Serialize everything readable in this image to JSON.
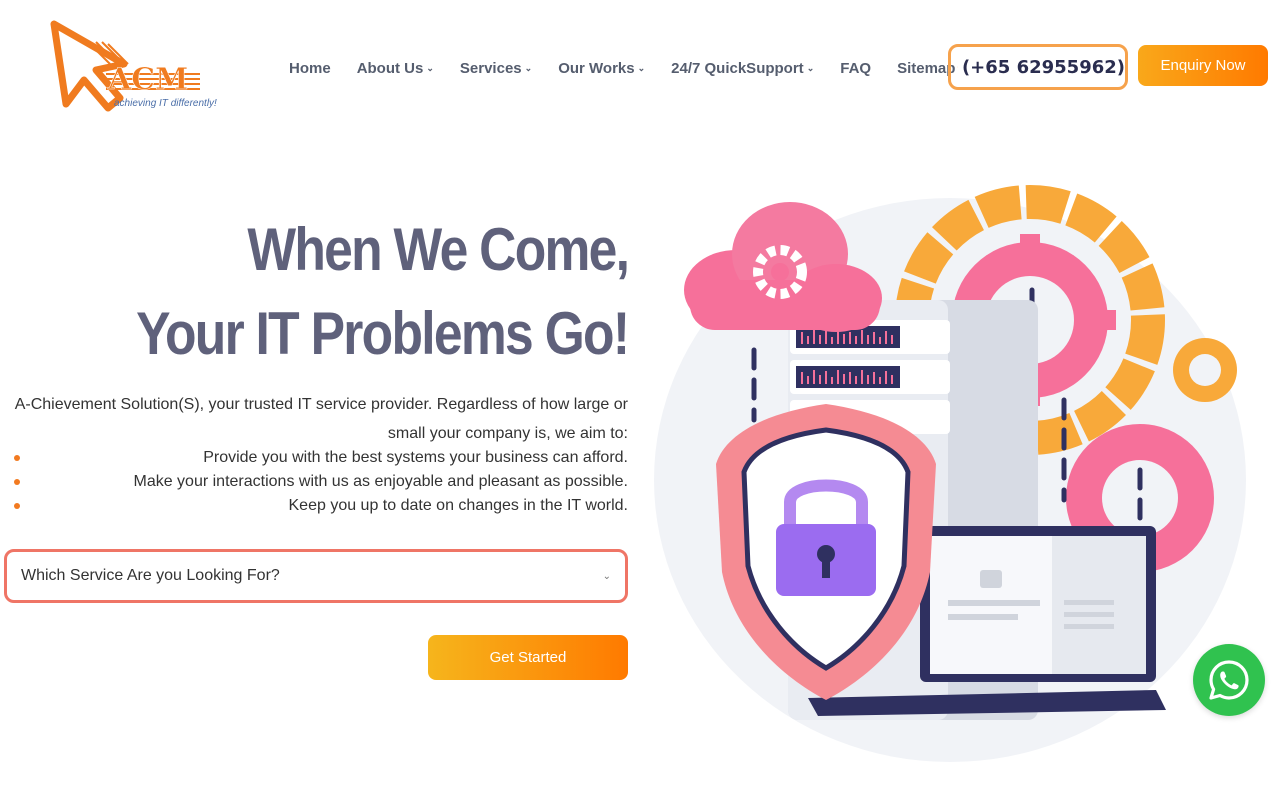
{
  "brand": {
    "logo_text": "ACM",
    "tagline": "achieving IT differently!",
    "accent_color": "#f07b1f",
    "logo_icon": "cursor-arrow-logo-icon"
  },
  "nav": {
    "items": [
      {
        "label": "Home",
        "has_dropdown": false
      },
      {
        "label": "About Us",
        "has_dropdown": true
      },
      {
        "label": "Services",
        "has_dropdown": true
      },
      {
        "label": "Our Works",
        "has_dropdown": true
      },
      {
        "label": "24/7 QuickSupport",
        "has_dropdown": true
      },
      {
        "label": "FAQ",
        "has_dropdown": false
      },
      {
        "label": "Sitemap",
        "has_dropdown": false
      }
    ],
    "dropdown_icon": "chevron-down-icon"
  },
  "phone": {
    "number": "(+65 62955962)",
    "icon": "phone-icon"
  },
  "enquiry_button": {
    "label": "Enquiry Now"
  },
  "hero": {
    "title_line1": "When We Come,",
    "title_line2": "Your IT Problems Go!",
    "description": "A-Chievement Solution(S), your trusted IT service provider. Regardless of how large or small your company is, we aim to:",
    "bullets": [
      "Provide you with the best systems your business can afford.",
      "Make your interactions with us as enjoyable and pleasant as possible.",
      "Keep you up to date on changes in the IT world."
    ]
  },
  "service_select": {
    "selected": "Which Service Are you Looking For?",
    "chevron_icon": "chevron-down-icon"
  },
  "cta": {
    "label": "Get Started"
  },
  "illustration": {
    "description_icon": "it-security-illustration",
    "colors": {
      "pink": "#f6709a",
      "orange": "#f8a93a",
      "purple": "#9b6cf0",
      "navy": "#2f3060"
    }
  },
  "whatsapp": {
    "icon": "whatsapp-icon",
    "color": "#30c24f"
  }
}
